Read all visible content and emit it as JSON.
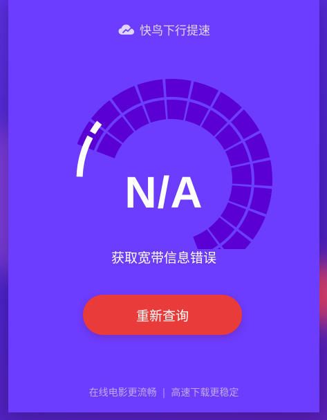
{
  "app": {
    "title": "快鸟下行提速"
  },
  "gauge": {
    "value": "N/A",
    "level": 0.08
  },
  "status": {
    "message": "获取宽带信息错误"
  },
  "actions": {
    "retry_label": "重新查询"
  },
  "footer": {
    "left": "在线电影更流畅",
    "separator": "|",
    "right": "高速下载更稳定"
  },
  "colors": {
    "card": "#6c3cff",
    "segment": "#5a00d4",
    "indicator": "#ffffff",
    "button": "#ea3b3b"
  },
  "icons": {
    "brand": "cloud-logo-icon"
  }
}
